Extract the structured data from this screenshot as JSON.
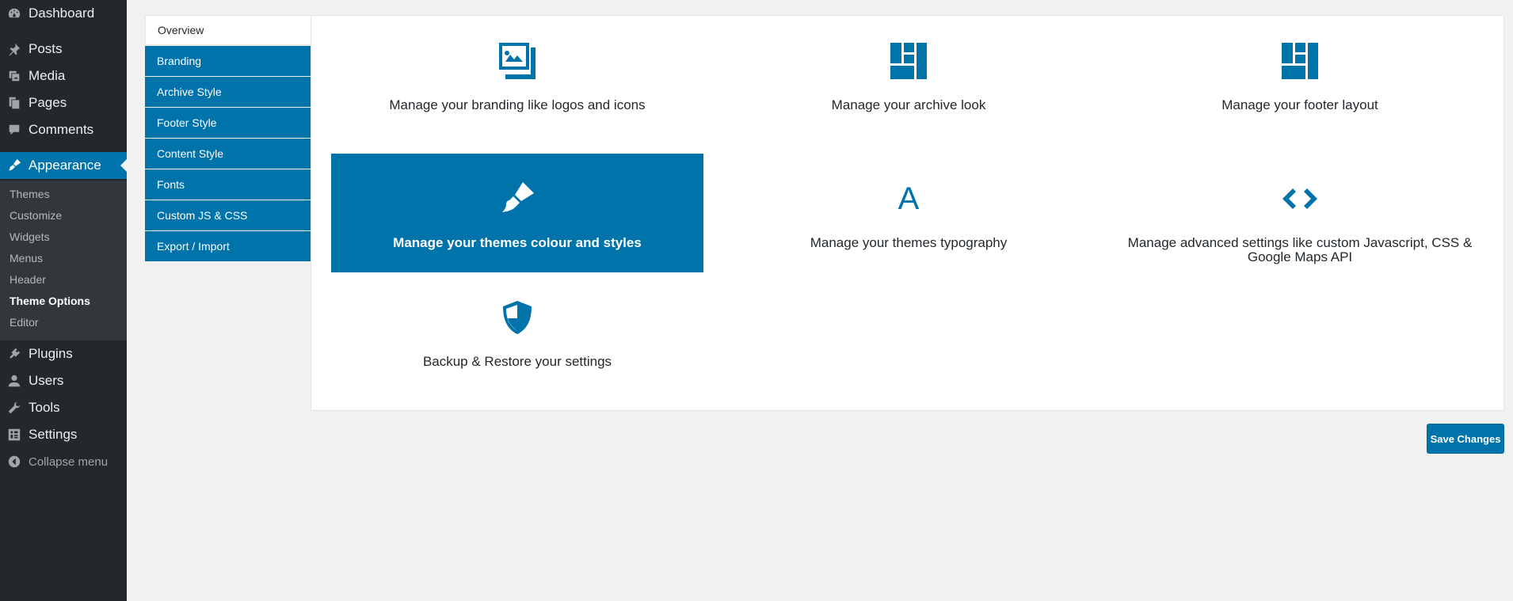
{
  "sidebar": {
    "items": [
      {
        "label": "Dashboard",
        "icon": "dashboard-icon"
      },
      {
        "label": "Posts",
        "icon": "pin-icon"
      },
      {
        "label": "Media",
        "icon": "media-icon"
      },
      {
        "label": "Pages",
        "icon": "pages-icon"
      },
      {
        "label": "Comments",
        "icon": "comment-icon"
      },
      {
        "label": "Appearance",
        "icon": "brush-icon"
      },
      {
        "label": "Plugins",
        "icon": "plug-icon"
      },
      {
        "label": "Users",
        "icon": "user-icon"
      },
      {
        "label": "Tools",
        "icon": "wrench-icon"
      },
      {
        "label": "Settings",
        "icon": "settings-icon"
      },
      {
        "label": "Collapse menu",
        "icon": "collapse-icon"
      }
    ],
    "submenu": [
      "Themes",
      "Customize",
      "Widgets",
      "Menus",
      "Header",
      "Theme Options",
      "Editor"
    ]
  },
  "tabs": [
    "Overview",
    "Branding",
    "Archive Style",
    "Footer Style",
    "Content Style",
    "Fonts",
    "Custom JS & CSS",
    "Export / Import"
  ],
  "cards": [
    {
      "label": "Manage your branding like logos and icons",
      "icon": "images-icon"
    },
    {
      "label": "Manage your archive look",
      "icon": "layout-icon"
    },
    {
      "label": "Manage your footer layout",
      "icon": "layout-icon"
    },
    {
      "label": "Manage your themes colour and styles",
      "icon": "paintbrush-icon"
    },
    {
      "label": "Manage your themes typography",
      "icon": "letter-icon",
      "glyph": "A"
    },
    {
      "label": "Manage advanced settings like custom Javascript, CSS & Google Maps API",
      "icon": "code-icon"
    },
    {
      "label": "Backup & Restore your settings",
      "icon": "shield-icon"
    }
  ],
  "save_label": "Save Changes",
  "colors": {
    "accent": "#0073aa",
    "sidebar": "#23282d",
    "submenu": "#32373c",
    "background": "#f1f1f1"
  }
}
